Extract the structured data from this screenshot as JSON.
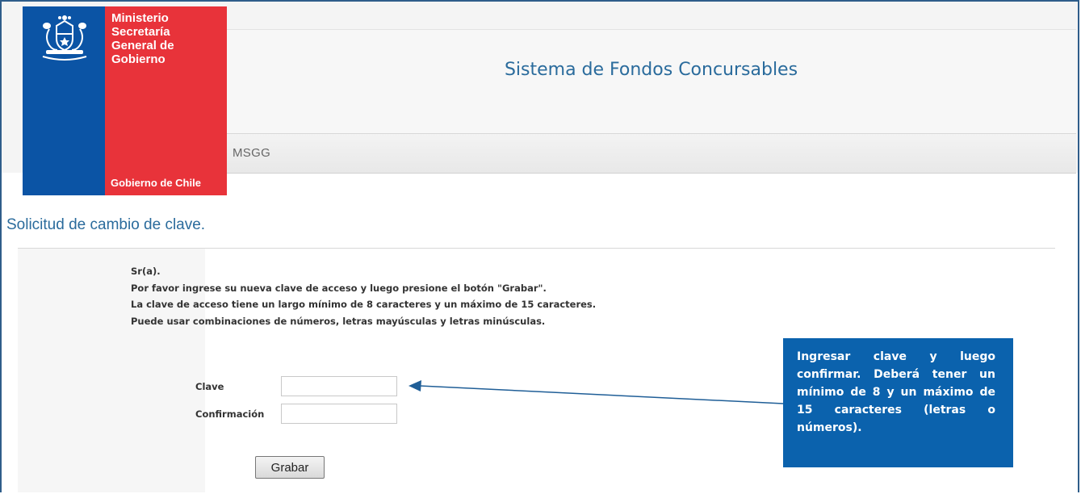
{
  "header": {
    "logo_lines": [
      "Ministerio",
      "Secretaría",
      "General de",
      "Gobierno"
    ],
    "logo_footer": "Gobierno de Chile",
    "site_title": "Sistema de Fondos Concursables",
    "nav_item": "MSGG"
  },
  "page": {
    "heading": "Solicitud de cambio de clave."
  },
  "instructions": [
    "Sr(a).",
    "Por favor ingrese su nueva clave de acceso y luego presione el botón \"Grabar\".",
    "La clave de acceso tiene un largo mínimo de 8 caracteres y un máximo de 15 caracteres.",
    "Puede usar combinaciones de números, letras mayúsculas y letras minúsculas."
  ],
  "form": {
    "clave_label": "Clave",
    "clave_value": "",
    "confirmacion_label": "Confirmación",
    "confirmacion_value": "",
    "submit_label": "Grabar"
  },
  "callout": {
    "text": "Ingresar clave y luego confirmar. Deberá tener un mínimo de 8 y un máximo de 15 caracteres (letras o números)."
  },
  "colors": {
    "brand_blue": "#0b54a5",
    "brand_red": "#e8333a",
    "title_blue": "#2a6b9c",
    "callout_blue": "#0b62ad"
  }
}
